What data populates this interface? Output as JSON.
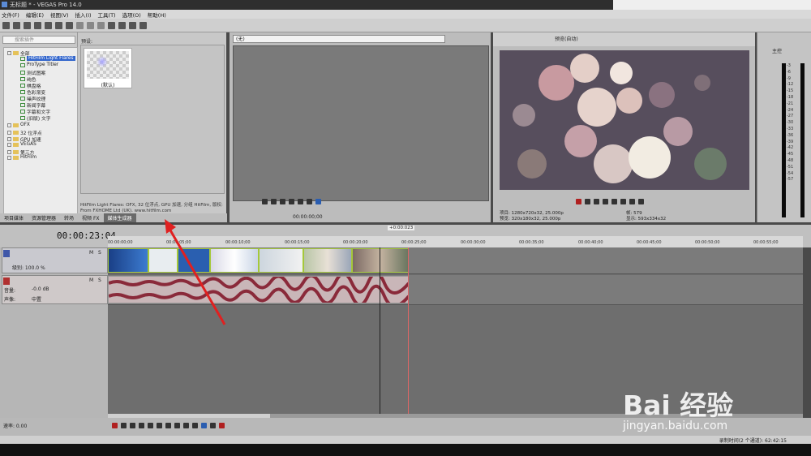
{
  "window": {
    "title": "无标题 * - VEGAS Pro 14.0"
  },
  "menu": [
    "文件(F)",
    "编辑(E)",
    "视图(V)",
    "插入(I)",
    "工具(T)",
    "选项(O)",
    "帮助(H)"
  ],
  "explorer": {
    "search_placeholder": "搜索插件",
    "items": [
      "全部",
      "HitFilm Light Flares",
      "ProType Titler",
      "测试图案",
      "纯色",
      "棋盘格",
      "色彩渐变",
      "噪声纹理",
      "新闻字幕",
      "字幕和文字",
      "(旧版) 文字",
      "OFX",
      "32 位浮点",
      "GPU 加速",
      "VEGAS",
      "第三方",
      "HitFilm"
    ]
  },
  "presets": {
    "label": "预设:",
    "default_name": "(默认)",
    "description": "HitFilm Light Flares: OFX, 32 位浮点, GPU 加速, 分组 HitFilm, 版权: From FXHOME Ltd (UK). www.hitfilm.com"
  },
  "tabs": [
    "项目媒体",
    "资源管理器",
    "转场",
    "视频 FX",
    "媒体生成器"
  ],
  "active_tab": "媒体生成器",
  "trimmer": {
    "selector": "(无)",
    "time": "00:00:00;00"
  },
  "preview": {
    "mode": "预览(自动)",
    "info_left": [
      "项目: 1280x720x32, 25.000p",
      "预览: 320x180x32, 25.000p"
    ],
    "info_right": [
      "帧: 579",
      "显示: 593x334x32"
    ]
  },
  "master": {
    "label": "主控",
    "scale": [
      "-3",
      "-6",
      "-9",
      "-12",
      "-15",
      "-18",
      "-21",
      "-24",
      "-27",
      "-30",
      "-33",
      "-36",
      "-39",
      "-42",
      "-45",
      "-48",
      "-51",
      "-54",
      "-57"
    ]
  },
  "timeline": {
    "current_time": "00:00:23:04",
    "ruler_marks": [
      "00:00:00;00",
      "00:00:05;00",
      "00:00:10;00",
      "00:00:15;00",
      "00:00:20;00",
      "00:00:25;00",
      "00:00:30;00",
      "00:00:35;00",
      "00:00:40;00",
      "00:00:45;00",
      "00:00:50;00",
      "00:00:55;00"
    ],
    "region_label": "+0:00:023"
  },
  "video_track": {
    "level": "级别: 100.0 %",
    "m": "M",
    "s": "S"
  },
  "audio_track": {
    "volume": "音量:",
    "volume_val": "-0.0 dB",
    "pan": "声像:",
    "pan_val": "中置",
    "m": "M",
    "s": "S"
  },
  "bottom": {
    "rate": "速率: 0.00"
  },
  "status": {
    "text": "录制时间(2 个通道): 62:42:15"
  },
  "watermark": {
    "logo": "Bai 经验",
    "url": "jingyan.baidu.com"
  }
}
